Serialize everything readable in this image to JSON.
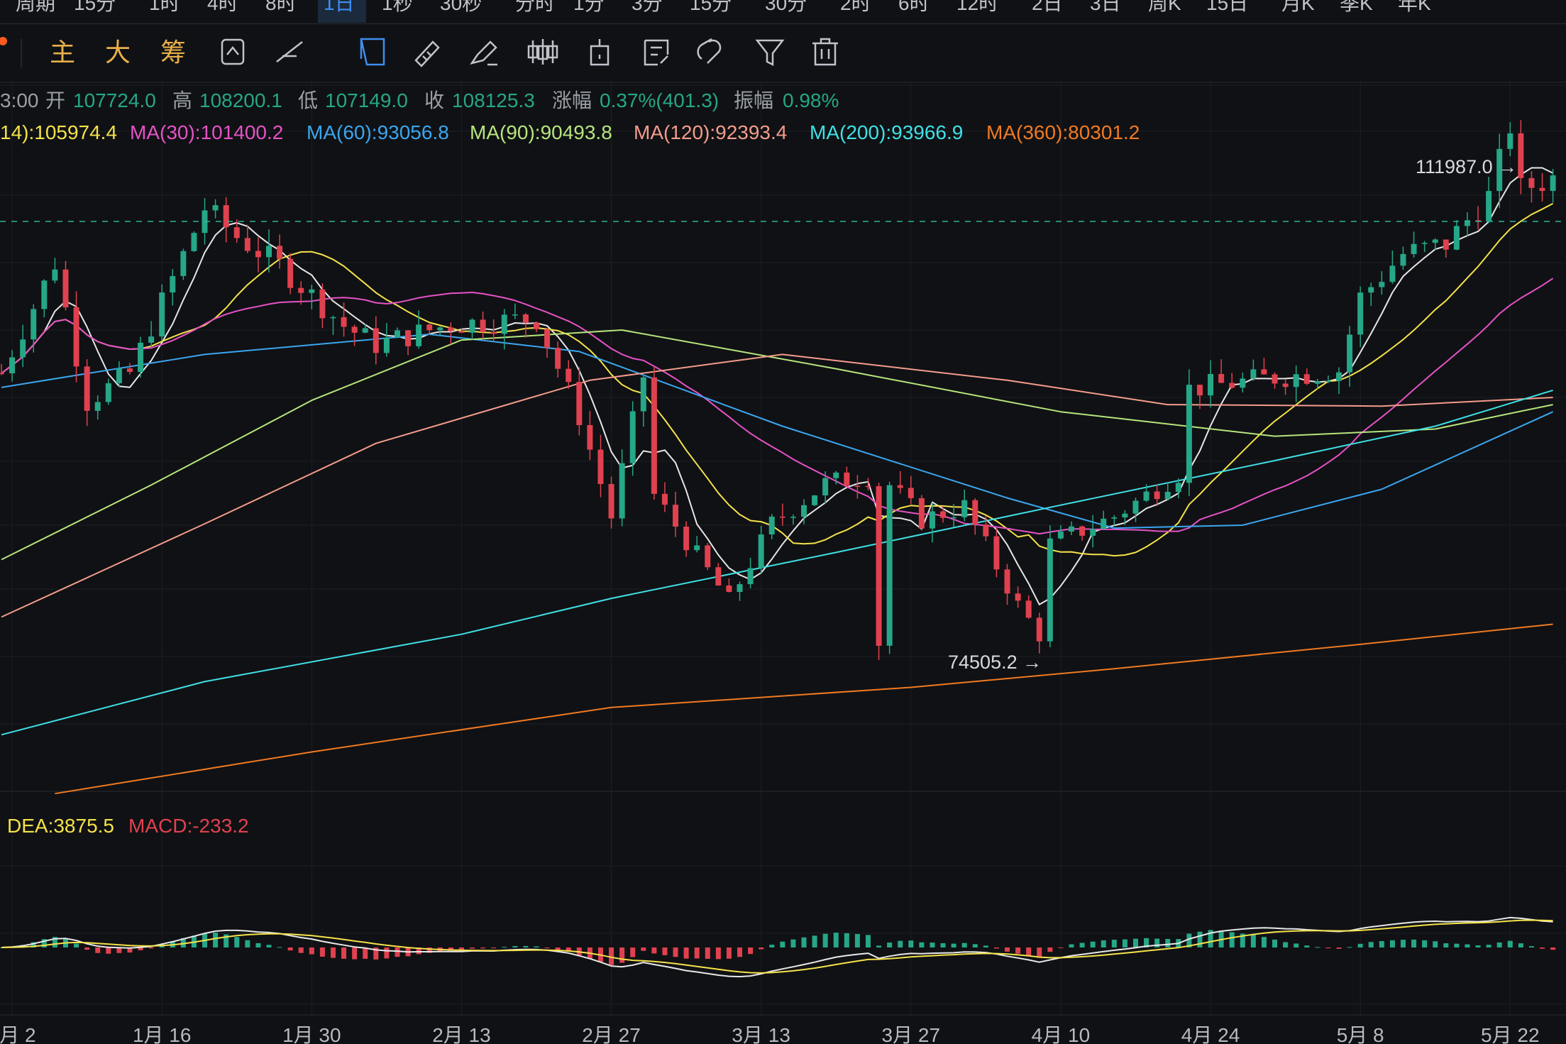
{
  "top_tabs": [
    "周期",
    "15分",
    "1时",
    "4时",
    "8时",
    "1日",
    "1秒",
    "30秒",
    "分时",
    "1分",
    "3分",
    "15分",
    "30分",
    "2时",
    "6时",
    "12时",
    "2日",
    "3日",
    "周K",
    "15日",
    "月K",
    "季K",
    "年K"
  ],
  "active_tab": "1日",
  "toolbar": {
    "indicator_labels": [
      "主",
      "大",
      "筹"
    ],
    "tools": [
      "sync-icon",
      "trend-line-icon",
      "select-box-icon",
      "ruler-icon",
      "brush-icon",
      "candle-icon",
      "bracket-icon",
      "note-icon",
      "magnet-icon",
      "filter-icon",
      "trash-icon"
    ],
    "accent": "#e8b04a",
    "active_tool_color": "#3d8ef0"
  },
  "ohlc": {
    "time": "3:00",
    "open_label": "开",
    "open": "107724.0",
    "high_label": "高",
    "high": "108200.1",
    "low_label": "低",
    "low": "107149.0",
    "close_label": "收",
    "close": "108125.3",
    "change_label": "涨幅",
    "change": "0.37%(401.3)",
    "amplitude_label": "振幅",
    "amplitude": "0.98%"
  },
  "ma_legend": [
    {
      "text": "14):105974.4",
      "color": "#f4e24a"
    },
    {
      "text": "MA(30):101400.2",
      "color": "#e552c6"
    },
    {
      "text": "MA(60):93056.8",
      "color": "#3aa6f0"
    },
    {
      "text": "MA(90):90493.8",
      "color": "#b7e57d"
    },
    {
      "text": "MA(120):92393.4",
      "color": "#f49c8c"
    },
    {
      "text": "MA(200):93966.9",
      "color": "#3fe0e6"
    },
    {
      "text": "MA(360):80301.2",
      "color": "#f07a22"
    }
  ],
  "macd_legend": [
    {
      "text": "DEA:3875.5",
      "color": "#f4e24a"
    },
    {
      "text": "MACD:-233.2",
      "color": "#e0414f"
    }
  ],
  "x_axis_labels": [
    "1月 2",
    "1月 16",
    "1月 30",
    "2月 13",
    "2月 27",
    "3月 13",
    "3月 27",
    "4月 10",
    "4月 24",
    "5月 8",
    "5月 22"
  ],
  "colors": {
    "up": "#25a788",
    "down": "#e0414f",
    "dif": "#e8e8e8",
    "dea": "#f4e24a"
  },
  "chart_data": {
    "type": "candlestick",
    "period": "1日",
    "annotations": [
      {
        "label": "111987.0",
        "kind": "max"
      },
      {
        "label": "74505.2",
        "kind": "min"
      }
    ],
    "ma_current": {
      "MA(30)": 101400.2,
      "MA(60)": 93056.8,
      "MA(90)": 90493.8,
      "MA(120)": 92393.4,
      "MA(200)": 93966.9,
      "MA(360)": 80301.2
    },
    "macd_current": {
      "DEA": 3875.5,
      "MACD": -233.2
    },
    "close_path": [
      [
        "01-01",
        94500
      ],
      [
        "01-06",
        102200
      ],
      [
        "01-09",
        92500
      ],
      [
        "01-13",
        94500
      ],
      [
        "01-20",
        106000
      ],
      [
        "01-23",
        104000
      ],
      [
        "01-27",
        102000
      ],
      [
        "02-02",
        97800
      ],
      [
        "02-05",
        96500
      ],
      [
        "02-12",
        97900
      ],
      [
        "02-20",
        98300
      ],
      [
        "02-24",
        91500
      ],
      [
        "02-27",
        84500
      ],
      [
        "03-02",
        94300
      ],
      [
        "03-03",
        86000
      ],
      [
        "03-10",
        78600
      ],
      [
        "03-14",
        84000
      ],
      [
        "03-19",
        86800
      ],
      [
        "03-24",
        87500
      ],
      [
        "03-28",
        84300
      ],
      [
        "04-01",
        85200
      ],
      [
        "04-06",
        78300
      ],
      [
        "04-08",
        76300
      ],
      [
        "04-09",
        82600
      ],
      [
        "04-15",
        84500
      ],
      [
        "04-21",
        87500
      ],
      [
        "04-22",
        93400
      ],
      [
        "04-30",
        94200
      ],
      [
        "05-06",
        94700
      ],
      [
        "05-08",
        99800
      ],
      [
        "05-12",
        102800
      ],
      [
        "05-16",
        103500
      ],
      [
        "05-20",
        106800
      ],
      [
        "05-22",
        111600
      ],
      [
        "05-23",
        107300
      ],
      [
        "05-26",
        108100
      ]
    ]
  }
}
